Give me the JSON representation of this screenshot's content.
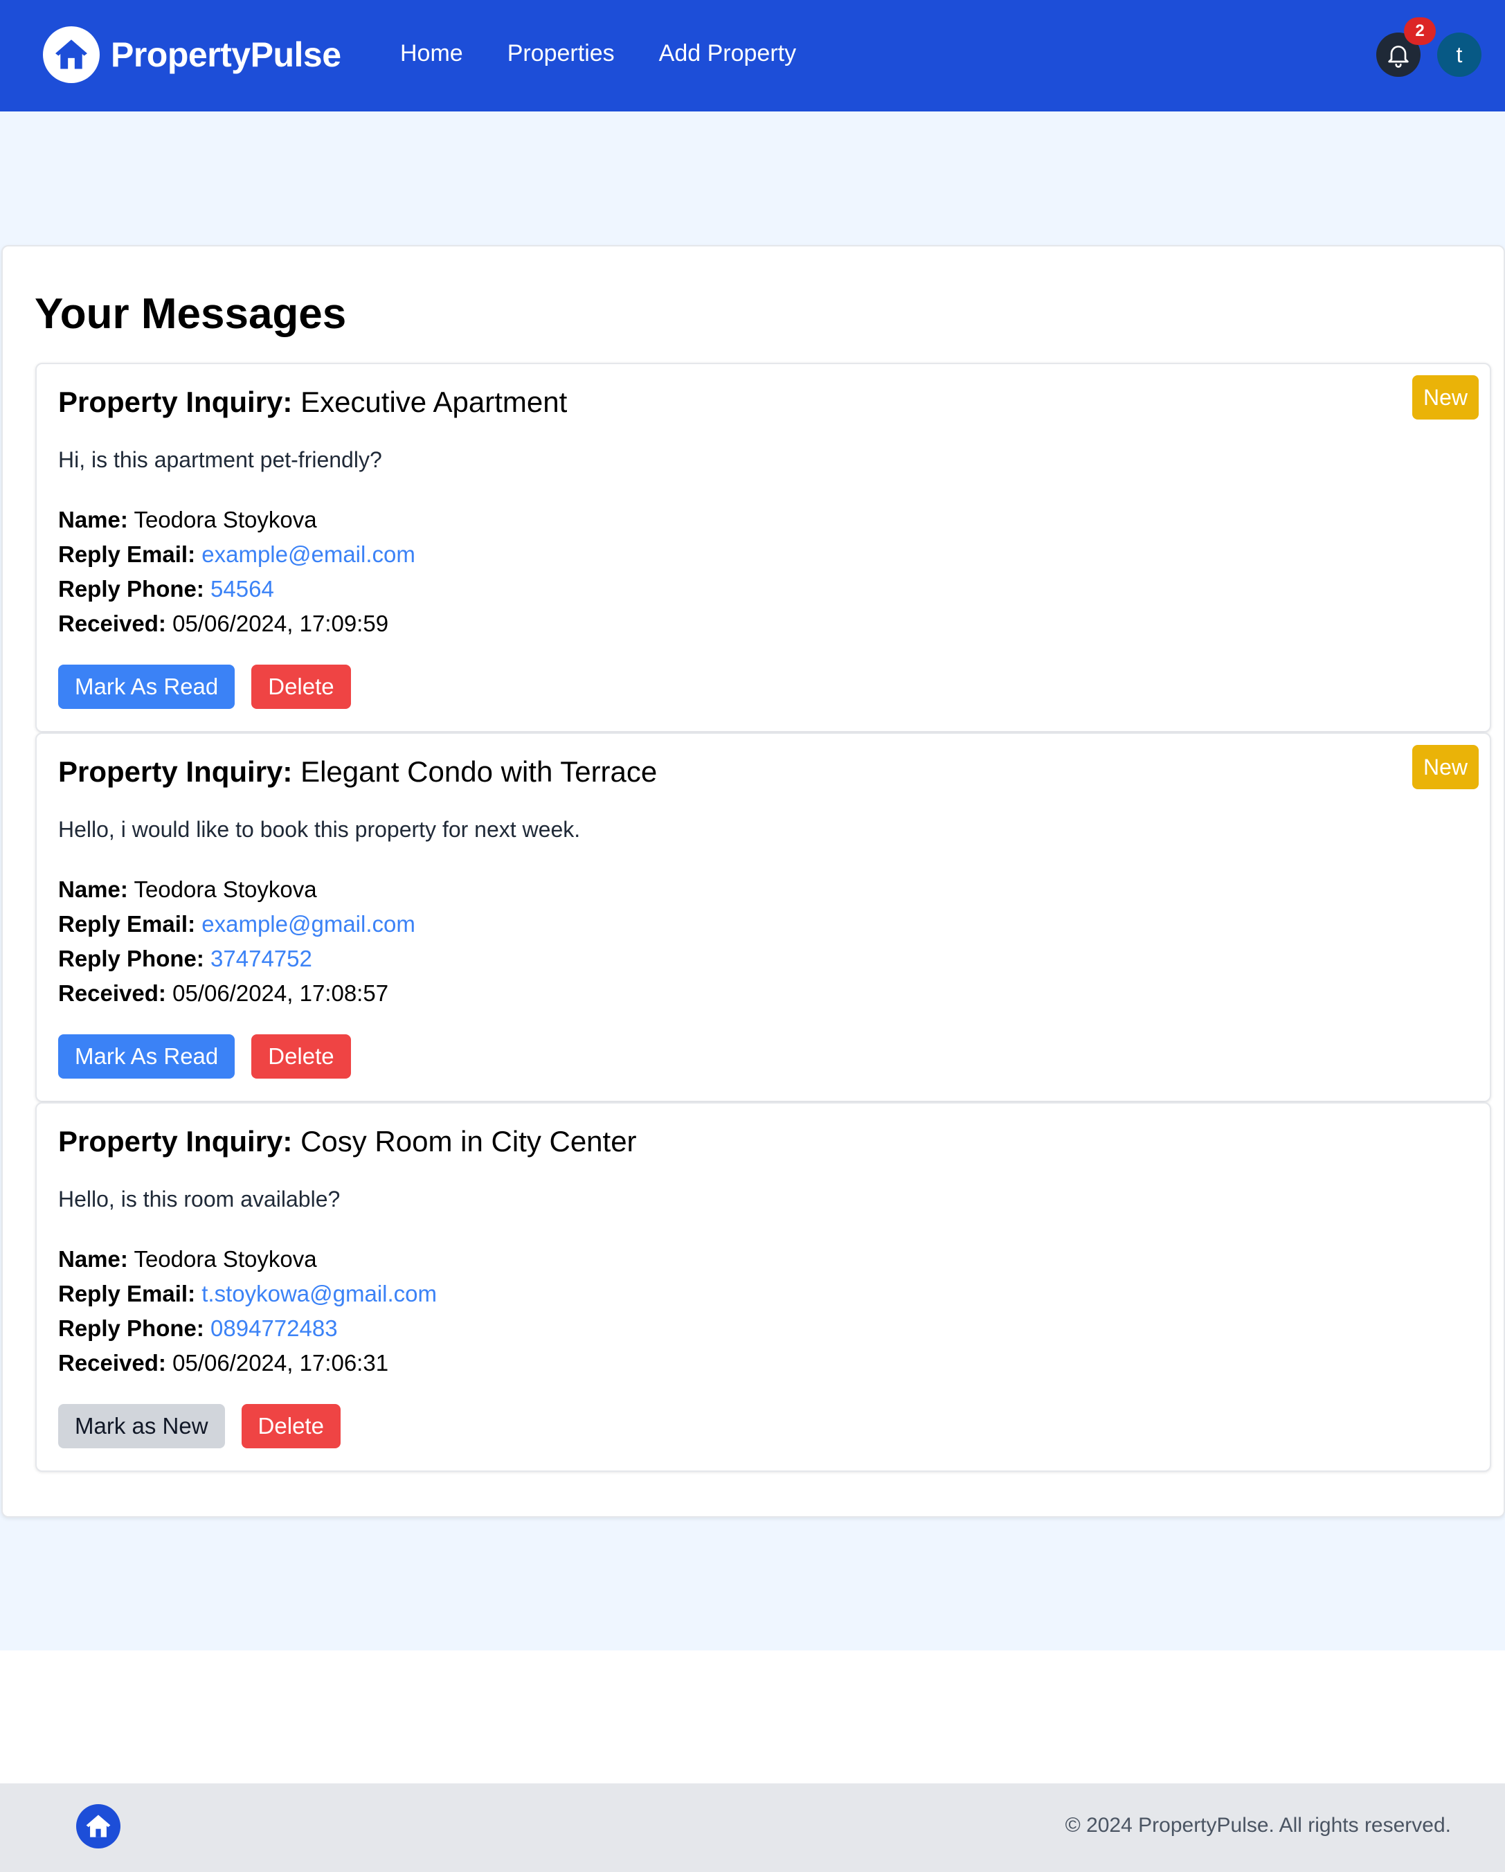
{
  "navbar": {
    "brand": "PropertyPulse",
    "logo_icon": "home-icon",
    "links": [
      "Home",
      "Properties",
      "Add Property"
    ],
    "notification_count": "2",
    "user_initial": "t",
    "colors": {
      "background": "#1d4ed8",
      "badge": "#dc2626",
      "avatar": "#075985"
    }
  },
  "page": {
    "title": "Your Messages"
  },
  "labels": {
    "subject": "Property Inquiry:",
    "name": "Name:",
    "email": "Reply Email:",
    "phone": "Reply Phone:",
    "received": "Received:",
    "new_badge": "New",
    "mark_read": "Mark As Read",
    "mark_new": "Mark as New",
    "delete": "Delete"
  },
  "messages": [
    {
      "property": "Executive Apartment",
      "body": "Hi, is this apartment pet-friendly?",
      "name": "Teodora Stoykova",
      "email": "example@email.com",
      "phone": "54564",
      "received": "05/06/2024, 17:09:59",
      "is_new": true
    },
    {
      "property": "Elegant Condo with Terrace",
      "body": "Hello, i would like to book this property for next week.",
      "name": "Teodora Stoykova",
      "email": "example@gmail.com",
      "phone": "37474752",
      "received": "05/06/2024, 17:08:57",
      "is_new": true
    },
    {
      "property": "Cosy Room in City Center",
      "body": "Hello, is this room available?",
      "name": "Teodora Stoykova",
      "email": "t.stoykowa@gmail.com",
      "phone": "0894772483",
      "received": "05/06/2024, 17:06:31",
      "is_new": false
    }
  ],
  "footer": {
    "logo_icon": "home-icon",
    "copyright": "© 2024 PropertyPulse. All rights reserved."
  }
}
